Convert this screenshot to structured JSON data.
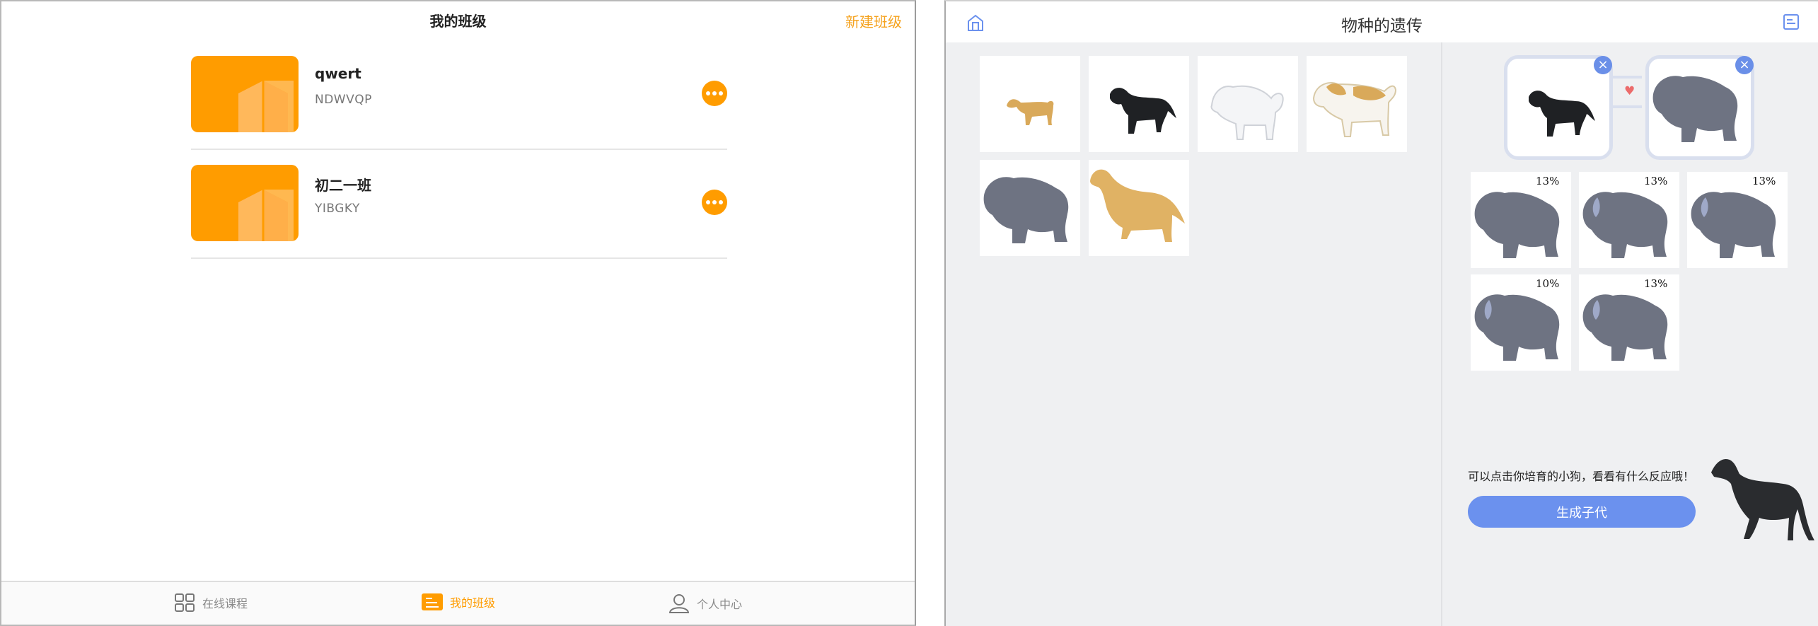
{
  "left": {
    "header": {
      "title": "我的班级",
      "new_class": "新建班级"
    },
    "classes": [
      {
        "name": "qwert",
        "code": "NDWVQP"
      },
      {
        "name": "初二一班",
        "code": "YIBGKY"
      }
    ],
    "tabs": [
      {
        "label": "在线课程",
        "icon": "grid-icon",
        "active": false
      },
      {
        "label": "我的班级",
        "icon": "class-icon",
        "active": true
      },
      {
        "label": "个人中心",
        "icon": "person-icon",
        "active": false
      }
    ],
    "colors": {
      "accent": "#ff9c00"
    }
  },
  "right": {
    "header": {
      "title": "物种的遗传"
    },
    "breeds": [
      "chihuahua-dog",
      "black-labrador-dog",
      "white-spitz-dog",
      "saint-bernard-dog",
      "chow-chow-dog",
      "golden-retriever-dog"
    ],
    "parents": [
      "black-labrador-dog",
      "chow-chow-dog"
    ],
    "offspring": [
      {
        "percent": "13%"
      },
      {
        "percent": "13%"
      },
      {
        "percent": "13%"
      },
      {
        "percent": "10%"
      },
      {
        "percent": "13%"
      }
    ],
    "hint": "可以点击你培育的小狗，看看有什么反应哦！",
    "generate_button": "生成子代",
    "colors": {
      "accent": "#6b91ee",
      "heart": "#ec6b6b"
    }
  }
}
